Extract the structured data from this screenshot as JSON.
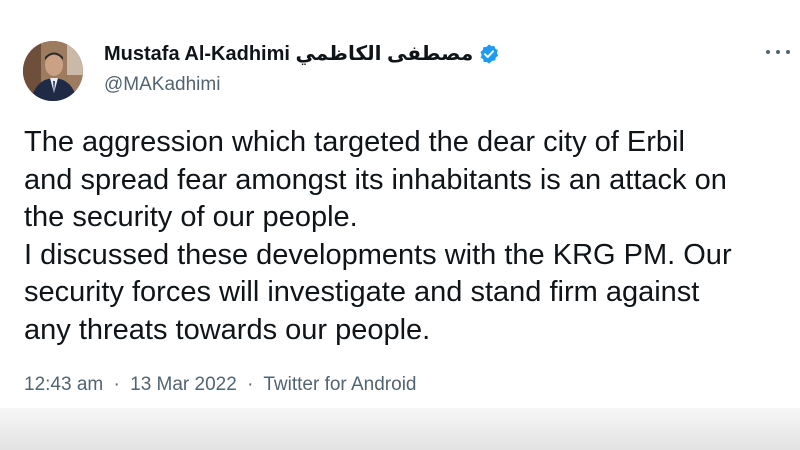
{
  "tweet": {
    "author": {
      "display_name": "Mustafa Al-Kadhimi مصطفى الكاظمي",
      "handle": "@MAKadhimi",
      "verified": true
    },
    "text_lines": [
      "The aggression which targeted the dear city of Erbil",
      "and spread fear amongst its inhabitants is an attack on",
      "the security of our people.",
      "I discussed these developments with the KRG PM. Our",
      "security forces will investigate and stand firm against",
      "any threats towards our people."
    ],
    "meta": {
      "time": "12:43 am",
      "separator": "·",
      "date": "13 Mar 2022",
      "source": "Twitter for Android"
    }
  },
  "icons": {
    "verified": "verified-badge-icon",
    "more": "more-horizontal-icon"
  },
  "colors": {
    "text": "#0f1419",
    "secondary": "#536471",
    "verified_blue": "#1d9bf0",
    "background": "#ffffff"
  }
}
